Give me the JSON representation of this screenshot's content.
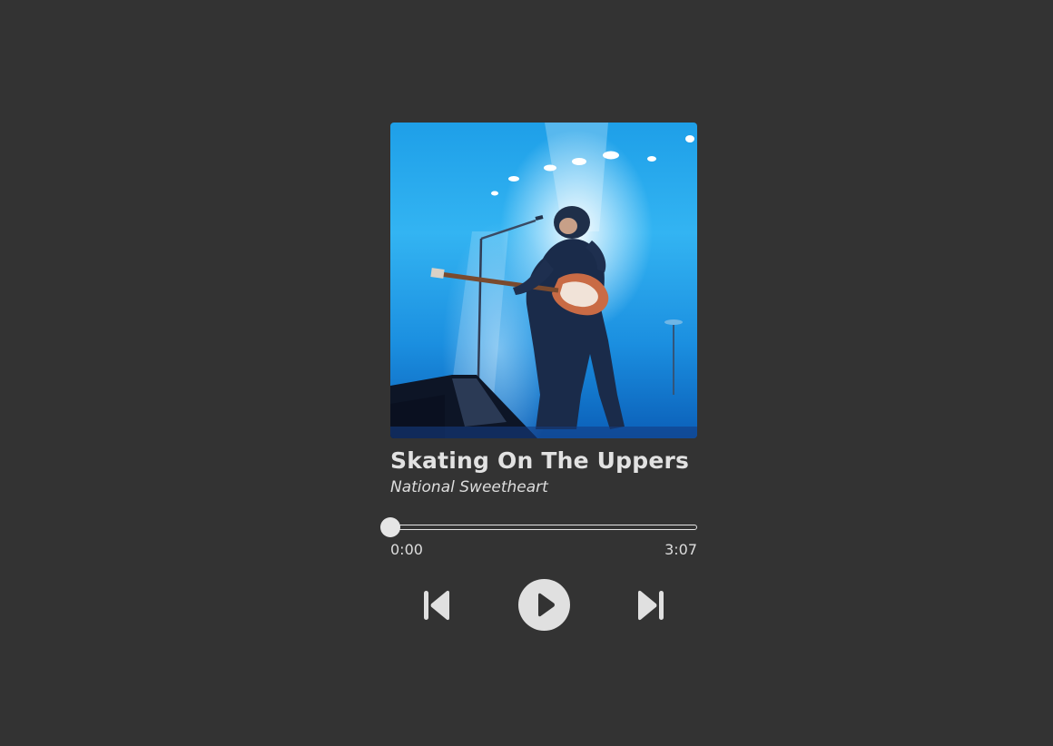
{
  "track": {
    "title": "Skating On The Uppers",
    "artist": "National Sweetheart"
  },
  "progress": {
    "current_time": "0:00",
    "total_time": "3:07",
    "fraction": 0
  },
  "controls": {
    "previous_icon": "skip-previous-icon",
    "play_icon": "play-icon",
    "next_icon": "skip-next-icon"
  },
  "colors": {
    "background": "#333333",
    "foreground": "#e5e5e5",
    "artwork_accent": "#1e9fe8"
  }
}
